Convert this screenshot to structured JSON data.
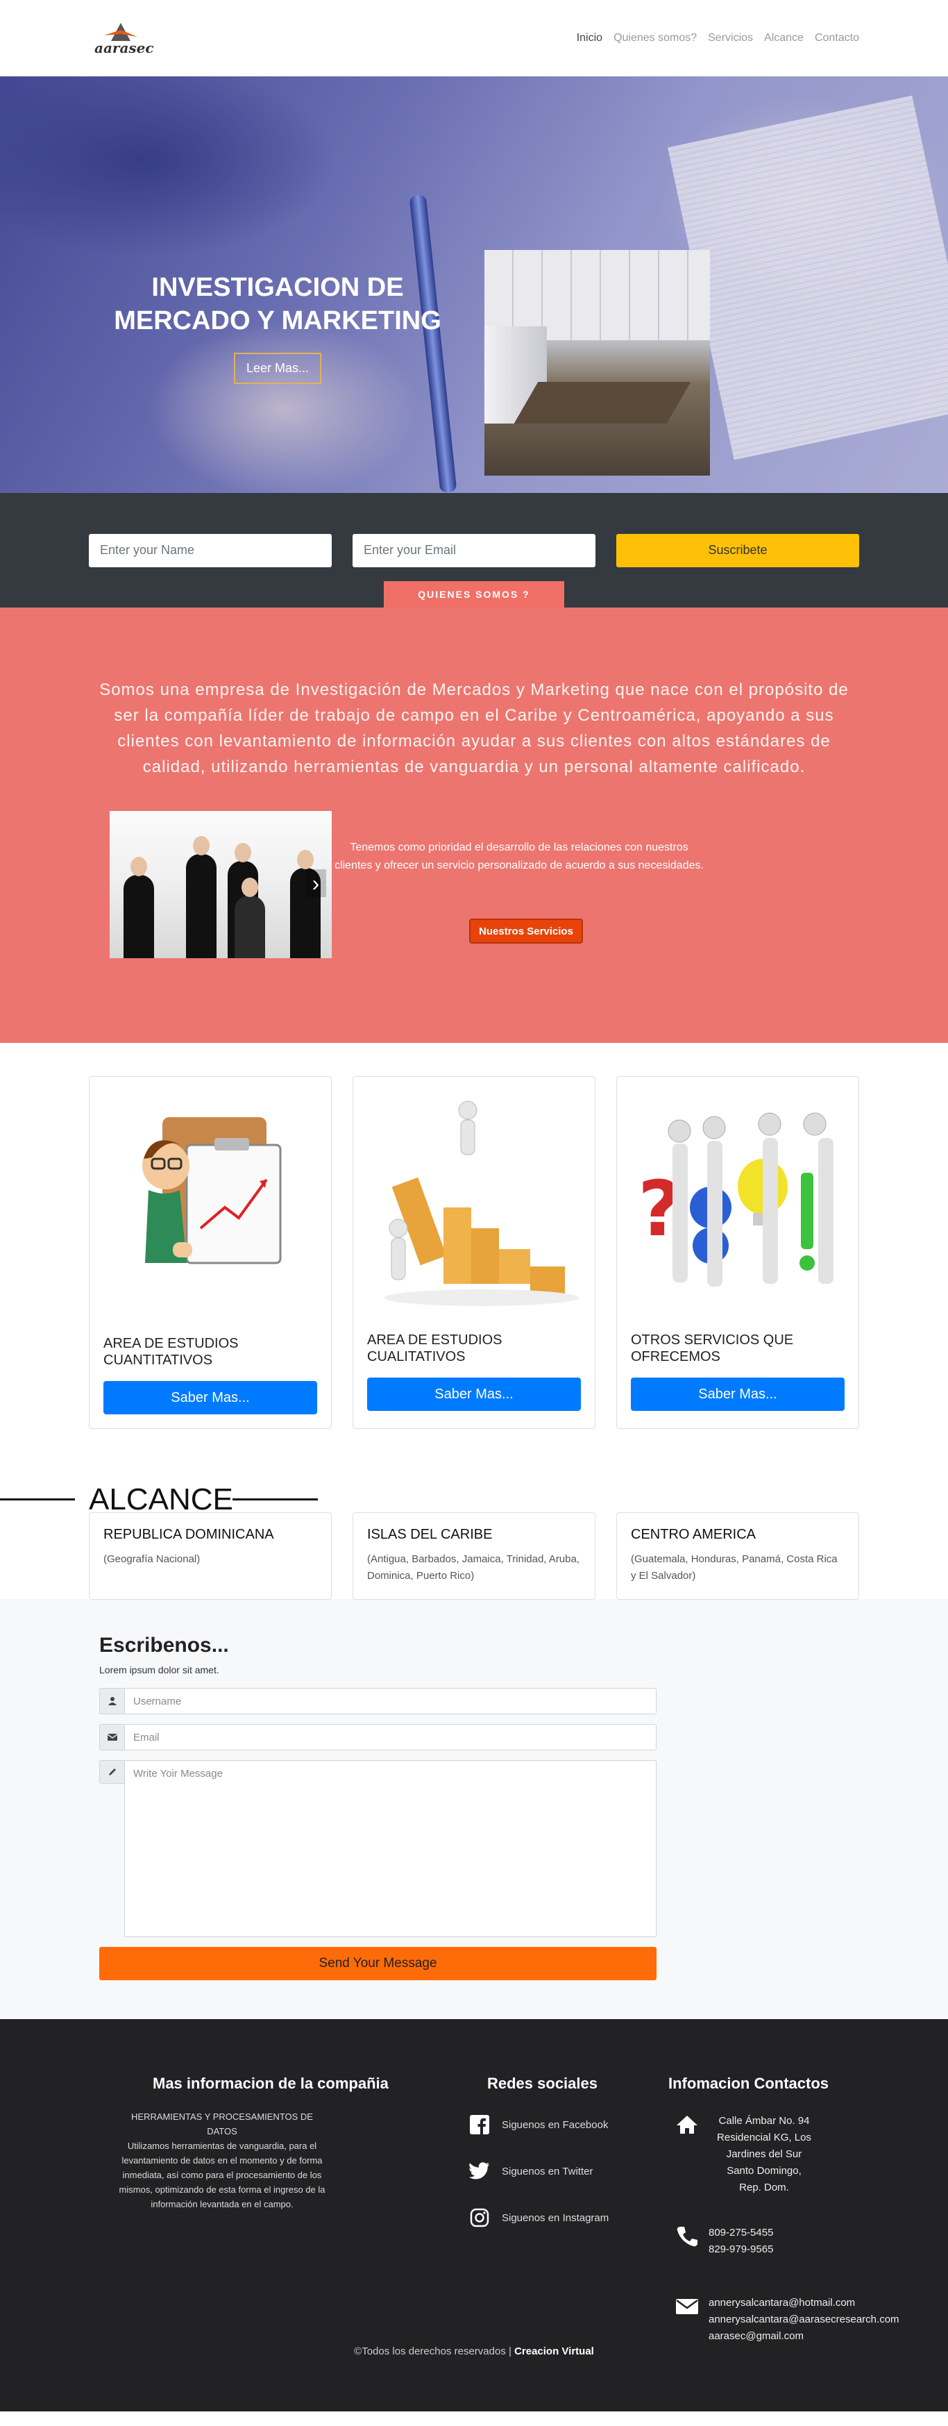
{
  "brand": {
    "name": "aarasec"
  },
  "nav": {
    "items": [
      "Inicio",
      "Quienes somos?",
      "Servicios",
      "Alcance",
      "Contacto"
    ]
  },
  "hero": {
    "title_line1": "INVESTIGACION DE",
    "title_line2": "MERCADO Y MARKETING",
    "cta": "Leer Mas..."
  },
  "subscribe": {
    "name_placeholder": "Enter your Name",
    "email_placeholder": "Enter your Email",
    "button": "Suscribete",
    "tab": "QUIENES SOMOS ?"
  },
  "about": {
    "text": "Somos una empresa de Investigación de Mercados y Marketing que nace con el propósito de ser la compañía líder de trabajo de campo en el Caribe y Centroamérica, apoyando a sus clientes con levantamiento de información ayudar a sus clientes con altos estándares de calidad, utilizando herramientas de vanguardia y un personal altamente calificado.",
    "subtext": "Tenemos como prioridad el desarrollo de las relaciones con nuestros clientes y ofrecer un servicio personalizado de acuerdo a sus necesidades.",
    "button": "Nuestros Servicios"
  },
  "services": [
    {
      "title_line1": "AREA DE ESTUDIOS",
      "title_line2": "CUANTITATIVOS",
      "button": "Saber Mas..."
    },
    {
      "title_line1": "AREA DE ESTUDIOS",
      "title_line2": "CUALITATIVOS",
      "button": "Saber Mas..."
    },
    {
      "title_line1": "OTROS SERVICIOS QUE",
      "title_line2": "OFRECEMOS",
      "button": "Saber Mas..."
    }
  ],
  "alcance": {
    "title": "ALCANCE",
    "regions": [
      {
        "title": "REPUBLICA DOMINICANA",
        "desc": "(Geografía Nacional)"
      },
      {
        "title": "ISLAS DEL CARIBE",
        "desc": "(Antigua, Barbados, Jamaica, Trinidad, Aruba, Dominica, Puerto Rico)"
      },
      {
        "title": "CENTRO AMERICA",
        "desc": "(Guatemala, Honduras, Panamá, Costa Rica y El Salvador)"
      }
    ]
  },
  "contact": {
    "title": "Escribenos...",
    "subtitle": "Lorem ipsum dolor sit amet.",
    "username_placeholder": "Username",
    "email_placeholder": "Email",
    "message_placeholder": "Write Yoir Message",
    "button": "Send Your Message"
  },
  "footer": {
    "about_title": "Mas informacion de la compañia",
    "about_heading": "HERRAMIENTAS Y PROCESAMIENTOS DE DATOS",
    "about_text": "Utilizamos herramientas de vanguardia, para el levantamiento de datos en el momento y de forma inmediata, así como para el procesamiento de los mismos, optimizando de esta forma el ingreso de la información levantada en el campo.",
    "social_title": "Redes sociales",
    "social": [
      "Siguenos en Facebook",
      "Siguenos en Twitter",
      "Siguenos en Instagram"
    ],
    "info_title": "Infomacion Contactos",
    "address": [
      "Calle Ámbar No. 94",
      "Residencial KG, Los",
      "Jardines del Sur",
      "Santo Domingo,",
      "Rep. Dom."
    ],
    "phones": [
      "809-275-5455",
      "829-979-9565"
    ],
    "emails": [
      "annerysalcantara@hotmail.com",
      "annerysalcantara@aarasecresearch.com",
      "aarasec@gmail.com"
    ],
    "copyright": "©Todos los derechos reservados |",
    "credit": "Creacion Virtual"
  },
  "icons": {
    "user": "person-icon",
    "email": "envelope-icon",
    "message": "pencil-icon",
    "home": "home-icon",
    "phone": "phone-icon",
    "mail": "mail-icon"
  },
  "colors": {
    "subscribe_bg": "#343a40",
    "accent_yellow": "#ffc107",
    "about_bg": "#ec7570",
    "primary_blue": "#007bff",
    "send_orange": "#ff6b08",
    "footer_bg": "#222224"
  }
}
